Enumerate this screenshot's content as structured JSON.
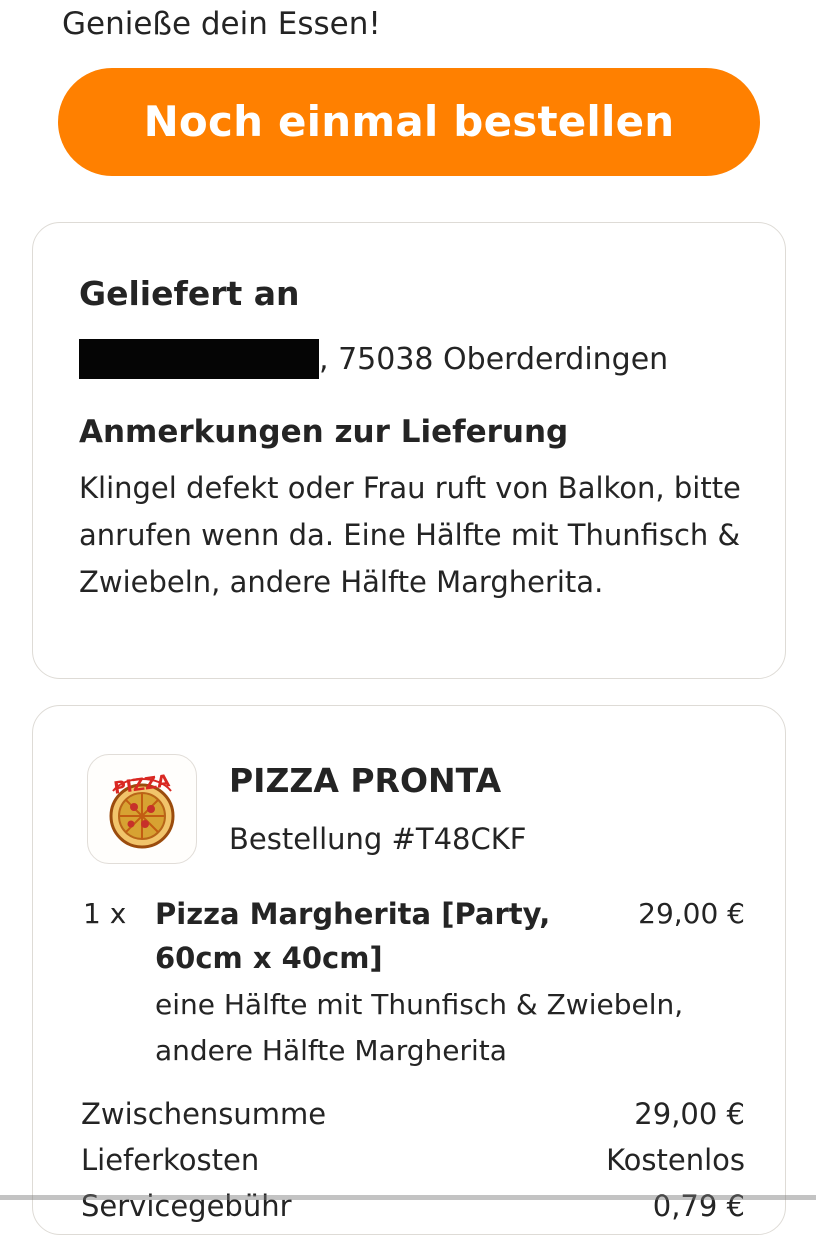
{
  "header": {
    "message": "Genieße dein Essen!"
  },
  "actions": {
    "reorder_label": "Noch einmal bestellen"
  },
  "delivery": {
    "title": "Geliefert an",
    "address_suffix": ", 75038 Oberderdingen",
    "notes_title": "Anmerkungen zur Lieferung",
    "notes": "Klingel defekt oder Frau ruft von Balkon, bitte anrufen wenn da. Eine Hälfte mit Thunfisch & Zwiebeln, andere Hälfte Margherita."
  },
  "restaurant": {
    "name": "PIZZA PRONTA",
    "logo_text": "PIZZA",
    "order_number": "Bestellung #T48CKF"
  },
  "items": [
    {
      "quantity": "1 x",
      "name": "Pizza Margherita [Party, 60cm x 40cm]",
      "price": "29,00 €",
      "description": "eine Hälfte mit Thunfisch & Zwiebeln, andere Hälfte Margherita"
    }
  ],
  "summary": {
    "subtotal_label": "Zwischensumme",
    "subtotal_value": "29,00 €",
    "delivery_label": "Lieferkosten",
    "delivery_value": "Kostenlos",
    "service_label": "Servicegebühr",
    "service_value": "0,79 €"
  },
  "colors": {
    "accent": "#ff8000",
    "text": "#242424",
    "border": "#dedbd6",
    "background": "#ffffff"
  }
}
